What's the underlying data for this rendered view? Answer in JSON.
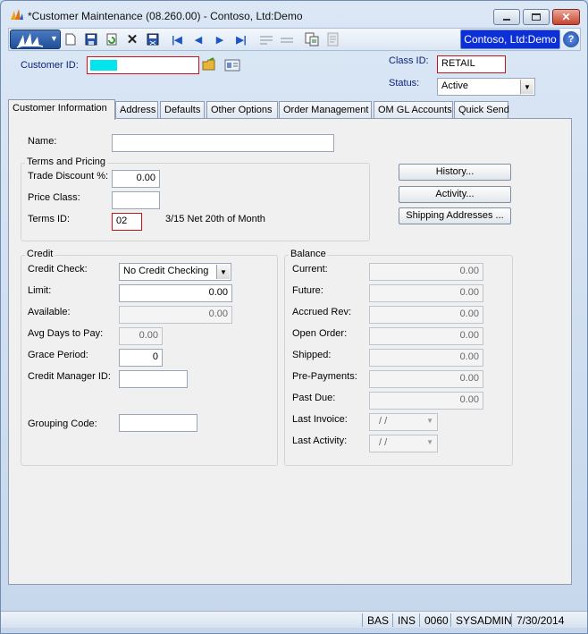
{
  "window": {
    "title": "*Customer Maintenance (08.260.00) - Contoso, Ltd:Demo",
    "company": "Contoso, Ltd:Demo",
    "help_glyph": "?"
  },
  "header": {
    "customer_id_label": "Customer ID:",
    "customer_id_value": "",
    "class_id_label": "Class ID:",
    "class_id_value": "RETAIL",
    "status_label": "Status:",
    "status_value": "Active"
  },
  "tabs": [
    {
      "label": "Customer Information",
      "active": true
    },
    {
      "label": "Address"
    },
    {
      "label": "Defaults"
    },
    {
      "label": "Other Options"
    },
    {
      "label": "Order Management"
    },
    {
      "label": "OM GL Accounts"
    },
    {
      "label": "Quick Send"
    }
  ],
  "info": {
    "name_label": "Name:",
    "name_value": "",
    "terms_title": "Terms and Pricing",
    "trade_discount_label": "Trade Discount %:",
    "trade_discount_value": "0.00",
    "price_class_label": "Price Class:",
    "price_class_value": "",
    "terms_id_label": "Terms ID:",
    "terms_id_value": "02",
    "terms_description": "3/15 Net 20th of Month",
    "history_button": "History...",
    "activity_button": "Activity...",
    "shipping_button": "Shipping Addresses ..."
  },
  "credit": {
    "title": "Credit",
    "credit_check_label": "Credit Check:",
    "credit_check_value": "No Credit Checking",
    "limit_label": "Limit:",
    "limit_value": "0.00",
    "available_label": "Available:",
    "available_value": "0.00",
    "avg_days_label": "Avg Days to Pay:",
    "avg_days_value": "0.00",
    "grace_label": "Grace Period:",
    "grace_value": "0",
    "manager_label": "Credit Manager ID:",
    "manager_value": "",
    "grouping_label": "Grouping Code:",
    "grouping_value": ""
  },
  "balance": {
    "title": "Balance",
    "current_label": "Current:",
    "current_value": "0.00",
    "future_label": "Future:",
    "future_value": "0.00",
    "accrued_label": "Accrued Rev:",
    "accrued_value": "0.00",
    "open_order_label": "Open Order:",
    "open_order_value": "0.00",
    "shipped_label": "Shipped:",
    "shipped_value": "0.00",
    "prepay_label": "Pre-Payments:",
    "prepay_value": "0.00",
    "past_due_label": "Past Due:",
    "past_due_value": "0.00",
    "last_invoice_label": "Last Invoice:",
    "last_invoice_value": "/ /",
    "last_activity_label": "Last Activity:",
    "last_activity_value": "/ /"
  },
  "statusbar": {
    "mode": "BAS",
    "insert": "INS",
    "code": "0060",
    "user": "SYSADMIN",
    "date": "7/30/2014"
  },
  "colors": {
    "company_badge": "#0d2fd6",
    "required_border": "#c0161b",
    "customer_id_fill": "#00e5ee"
  }
}
